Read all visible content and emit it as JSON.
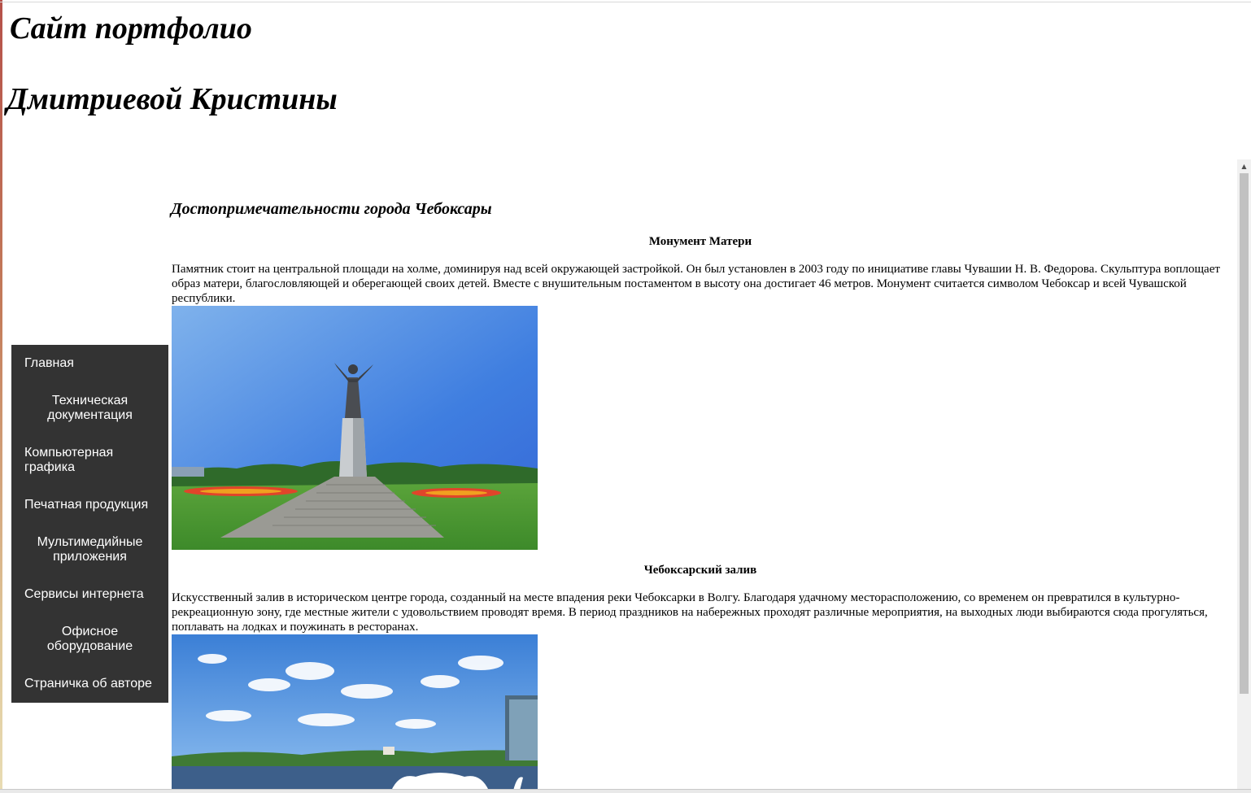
{
  "header": {
    "title_line1": "Сайт портфолио",
    "title_line2": "Дмитриевой Кристины"
  },
  "sidebar": {
    "items": [
      {
        "label": "Главная"
      },
      {
        "label": "Техническая документация"
      },
      {
        "label": "Компьютерная графика"
      },
      {
        "label": "Печатная продукция"
      },
      {
        "label": "Мультимедийные приложения"
      },
      {
        "label": "Сервисы интернета"
      },
      {
        "label": "Офисное оборудование"
      },
      {
        "label": "Страничка об авторе"
      }
    ],
    "background": "#333333",
    "text_color": "#ffffff"
  },
  "main": {
    "heading": "Достопримечательности города Чебоксары",
    "sights": [
      {
        "title": "Монумент Матери",
        "text": "Памятник стоит на центральной площади на холме, доминируя над всей окружающей застройкой. Он был установлен в 2003 году по инициативе главы Чувашии Н. В. Федорова. Скульптура воплощает образ матери, благословляющей и оберегающей своих детей. Вместе с внушительным постаментом в высоту она достигает 46 метров. Монумент считается символом Чебоксар и всей Чувашской республики.",
        "image": "mother-monument-photo"
      },
      {
        "title": "Чебоксарский залив",
        "text": "Искусственный залив в историческом центре города, созданный на месте впадения реки Чебоксарки в Волгу. Благодаря удачному месторасположению, со временем он превратился в культурно-рекреационную зону, где местные жители с удовольствием проводят время. В период праздников на набережных проходят различные мероприятия, на выходных люди выбираются сюда прогуляться, поплавать на лодках и поужинать в ресторанах.",
        "image": "cheboksary-bay-photo"
      }
    ]
  },
  "colors": {
    "left_stripe": "#b5514a",
    "scrollbar_thumb": "#c1c1c1"
  }
}
